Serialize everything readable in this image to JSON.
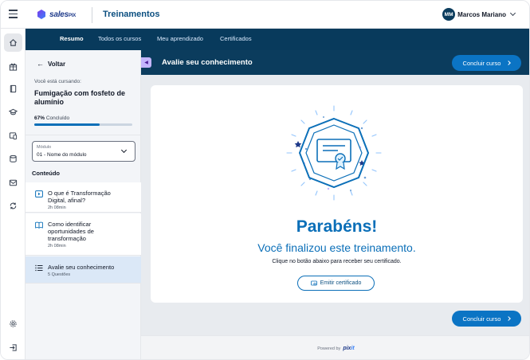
{
  "app": {
    "brand": "sales",
    "brand_suffix": "PIX",
    "title": "Treinamentos"
  },
  "user": {
    "initials": "MM",
    "name": "Marcos Mariano"
  },
  "nav": {
    "items": [
      {
        "label": "Resumo",
        "active": true
      },
      {
        "label": "Todos os cursos",
        "active": false
      },
      {
        "label": "Meu aprendizado",
        "active": false
      },
      {
        "label": "Certificados",
        "active": false
      }
    ]
  },
  "rail": {
    "icons": [
      "home-icon",
      "gift-icon",
      "book-icon",
      "graduation-cap-icon",
      "device-icon",
      "database-icon",
      "mail-icon",
      "cycle-icon",
      "settings-icon",
      "logout-icon"
    ]
  },
  "course": {
    "back_label": "Voltar",
    "cursando_label": "Você está cursando:",
    "name": "Fumigação com fosfeto de alumínio",
    "progress_value": "67%",
    "progress_suffix": "Concluído",
    "progress_fraction": 0.67,
    "module_label": "Módulo",
    "module_value": "01 - Nome do módulo",
    "content_heading": "Conteúdo",
    "lessons": [
      {
        "title": "O que é Transformação Digital, afinal?",
        "meta": "2h 08min",
        "icon": "video-icon",
        "active": false
      },
      {
        "title": "Como identificar oportunidades de transformação",
        "meta": "2h 08min",
        "icon": "book-open-icon",
        "active": false
      },
      {
        "title": "Avalie seu conhecimento",
        "meta": "5 Questões",
        "icon": "list-icon",
        "active": true
      }
    ]
  },
  "main": {
    "title": "Avalie seu conhecimento",
    "finish_label": "Concluir curso",
    "congrats_title": "Parabéns!",
    "congrats_subtitle": "Você finalizou este treinamento.",
    "congrats_hint": "Clique no botão abaixo para receber seu certificado.",
    "certificate_button": "Emitir certificado"
  },
  "footer": {
    "powered_label": "Powered by",
    "brand": "pix",
    "brand_accent": "it"
  },
  "colors": {
    "primary": "#0b6fb8",
    "navy": "#0b3c5d",
    "accent_purple": "#c4b5fd"
  }
}
